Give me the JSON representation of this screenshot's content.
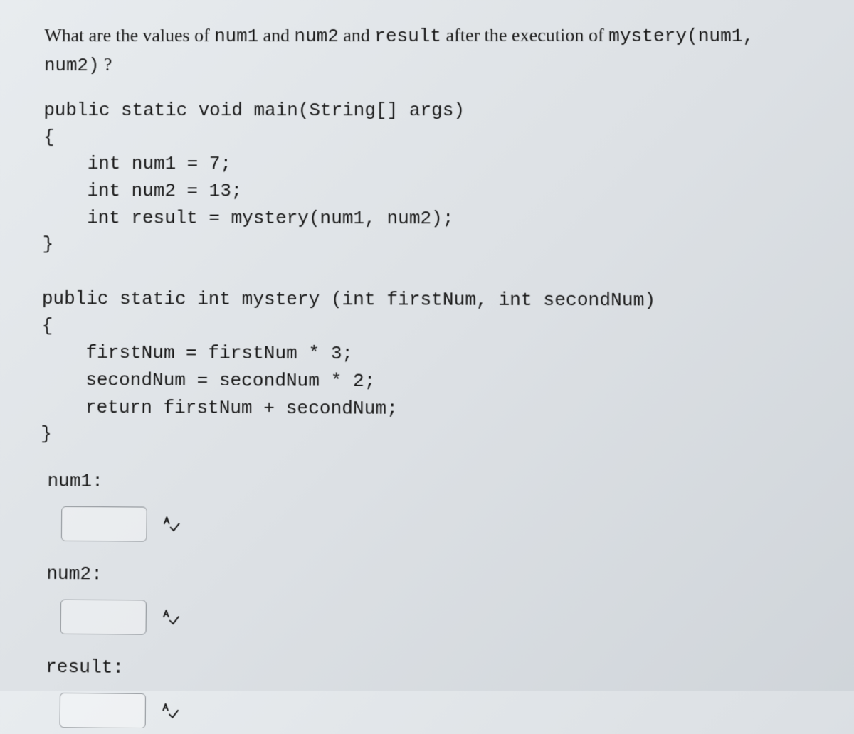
{
  "question": {
    "prefix": "What are the values of ",
    "var1": "num1",
    "mid1": " and ",
    "var2": "num2",
    "mid2": " and ",
    "var3": "result",
    "mid3": " after the execution of ",
    "call": "mystery(num1, num2)",
    "suffix": " ?"
  },
  "code": "public static void main(String[] args)\n{\n    int num1 = 7;\n    int num2 = 13;\n    int result = mystery(num1, num2);\n}\n\npublic static int mystery (int firstNum, int secondNum)\n{\n    firstNum = firstNum * 3;\n    secondNum = secondNum * 2;\n    return firstNum + secondNum;\n}",
  "answers": {
    "num1": {
      "label": "num1:",
      "value": ""
    },
    "num2": {
      "label": "num2:",
      "value": ""
    },
    "result": {
      "label": "result:",
      "value": ""
    }
  }
}
